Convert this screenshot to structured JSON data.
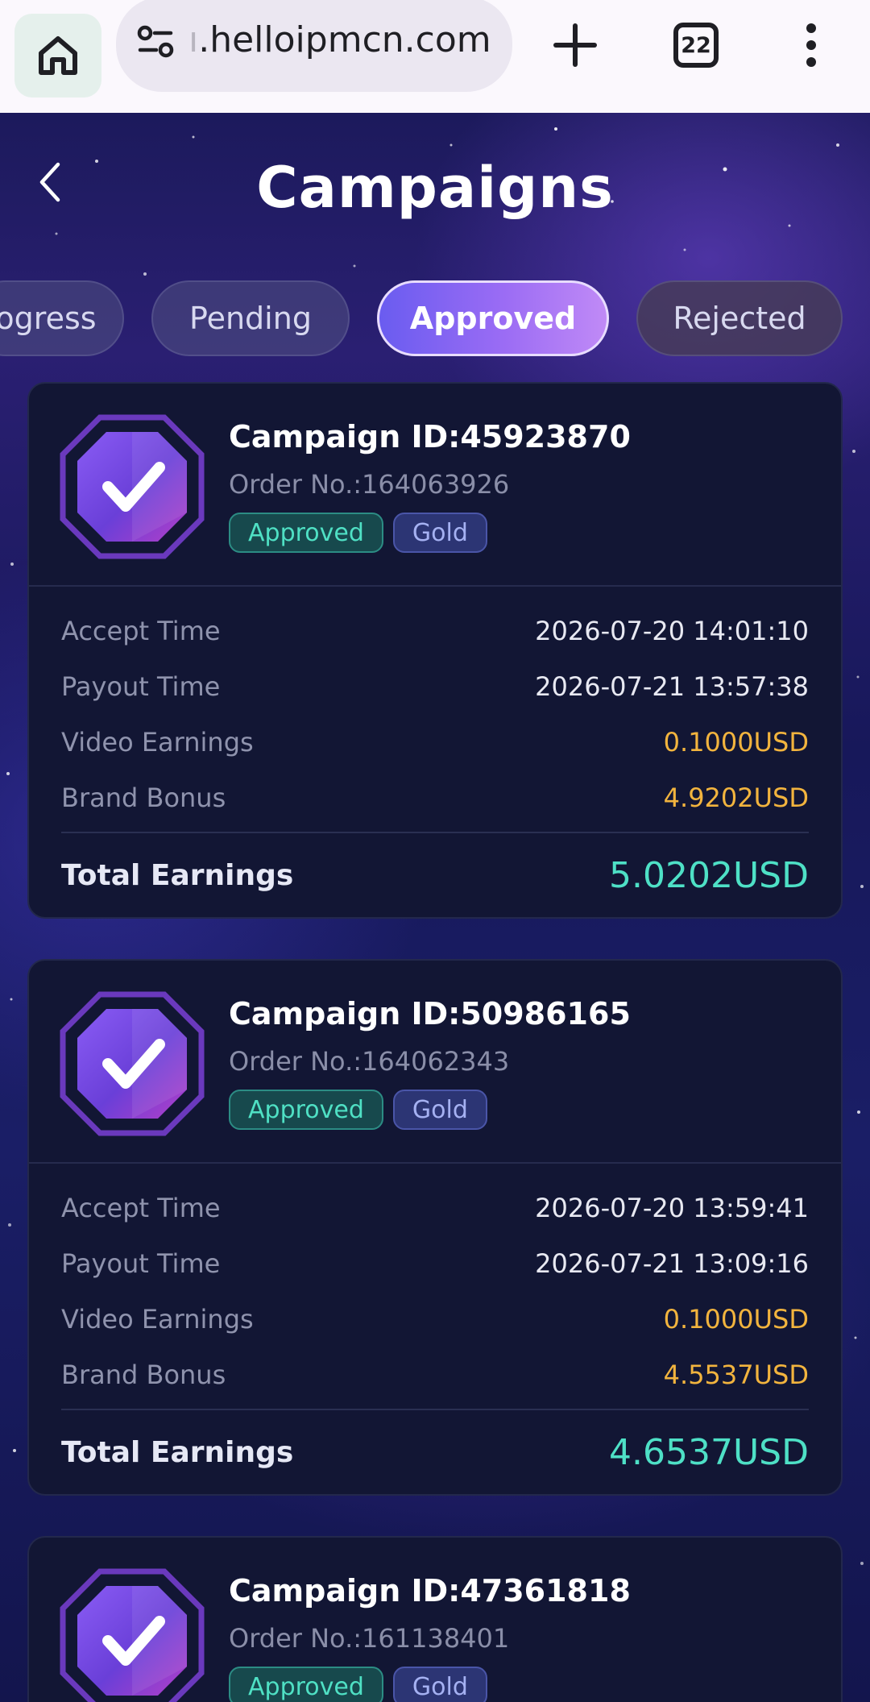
{
  "browser": {
    "url_faded": "ı",
    "url": ".helloipmcn.com",
    "tab_count": "22"
  },
  "header": {
    "title": "Campaigns"
  },
  "tabs": [
    {
      "label": "ogress",
      "active": false
    },
    {
      "label": "Pending",
      "active": false
    },
    {
      "label": "Approved",
      "active": true
    },
    {
      "label": "Rejected",
      "active": false
    }
  ],
  "labels": {
    "accept_time": "Accept Time",
    "payout_time": "Payout Time",
    "video_earnings": "Video Earnings",
    "brand_bonus": "Brand Bonus",
    "total_earnings": "Total Earnings"
  },
  "campaigns": [
    {
      "campaign_id": "Campaign ID:45923870",
      "order_no": "Order No.:164063926",
      "status": "Approved",
      "tier": "Gold",
      "accept_time": "2026-07-20 14:01:10",
      "payout_time": "2026-07-21 13:57:38",
      "video_earnings": "0.1000USD",
      "brand_bonus": "4.9202USD",
      "total_earnings": "5.0202USD"
    },
    {
      "campaign_id": "Campaign ID:50986165",
      "order_no": "Order No.:164062343",
      "status": "Approved",
      "tier": "Gold",
      "accept_time": "2026-07-20 13:59:41",
      "payout_time": "2026-07-21 13:09:16",
      "video_earnings": "0.1000USD",
      "brand_bonus": "4.5537USD",
      "total_earnings": "4.6537USD"
    },
    {
      "campaign_id": "Campaign ID:47361818",
      "order_no": "Order No.:161138401",
      "status": "Approved",
      "tier": "Gold"
    }
  ],
  "colors": {
    "accent_start": "#6a5cf0",
    "accent_end": "#c08af6",
    "money": "#f2b43e",
    "total": "#4ee0c6",
    "card_bg": "#121634"
  }
}
